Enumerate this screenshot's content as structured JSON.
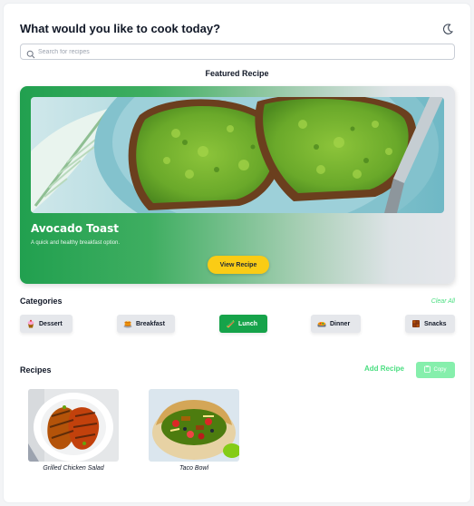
{
  "header": {
    "title": "What would you like to cook today?",
    "theme_icon": "moon-icon"
  },
  "search": {
    "placeholder": "Search for recipes",
    "icon": "search-icon"
  },
  "featured": {
    "heading": "Featured Recipe",
    "title": "Avocado Toast",
    "description": "A quick and healthy breakfast option.",
    "button_label": "View Recipe"
  },
  "categories": {
    "heading": "Categories",
    "clear_label": "Clear All",
    "items": [
      {
        "label": "Dessert",
        "icon": "cupcake-icon",
        "active": false
      },
      {
        "label": "Breakfast",
        "icon": "pancakes-icon",
        "active": false
      },
      {
        "label": "Lunch",
        "icon": "sandwich-icon",
        "active": true
      },
      {
        "label": "Dinner",
        "icon": "dinner-plate-icon",
        "active": false
      },
      {
        "label": "Snacks",
        "icon": "snack-icon",
        "active": false
      }
    ]
  },
  "recipes": {
    "heading": "Recipes",
    "add_label": "Add Recipe",
    "copy_label": "Copy",
    "items": [
      {
        "name": "Grilled Chicken Salad"
      },
      {
        "name": "Taco Bowl"
      }
    ]
  },
  "colors": {
    "accent": "#16a34a",
    "button_yellow": "#facc15",
    "link_green": "#4ade80"
  }
}
